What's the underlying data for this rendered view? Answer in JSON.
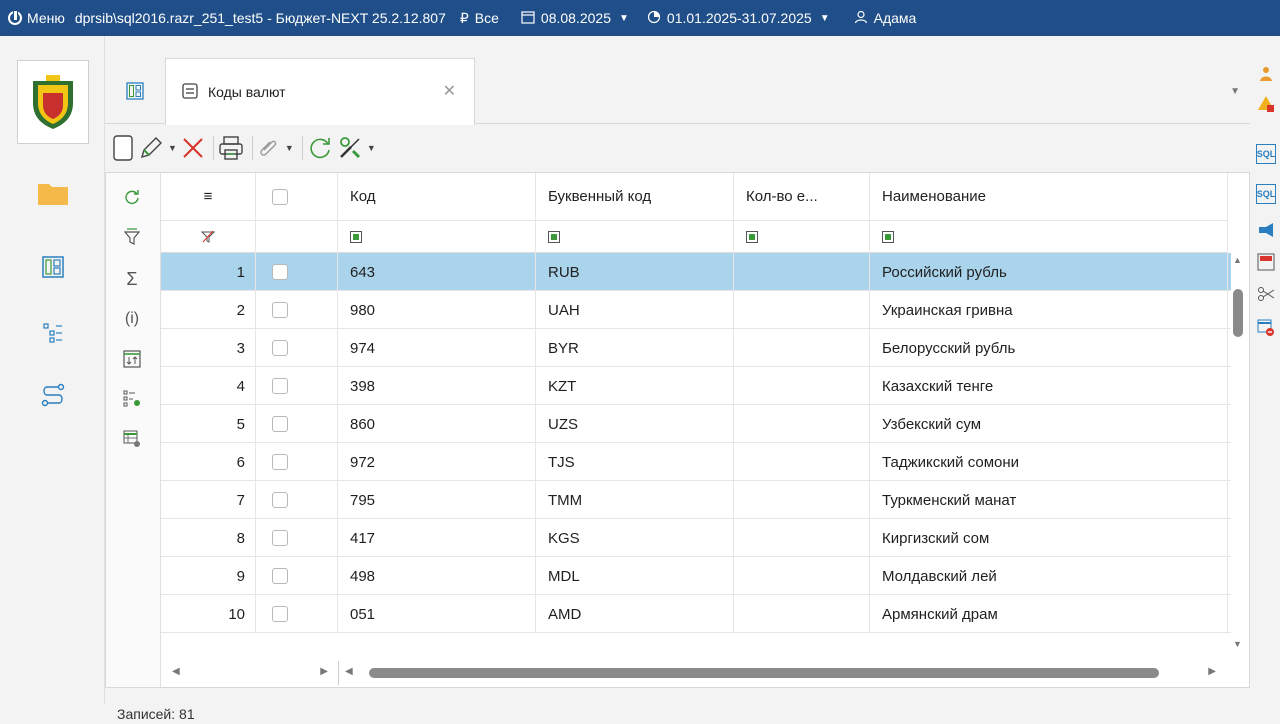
{
  "titlebar": {
    "menu_label": "Меню",
    "connection": "dprsib\\sql2016.razr_251_test5 - Бюджет-NEXT 25.2.12.807",
    "currency_glyph": "₽",
    "currency_filter": "Все",
    "date": "08.08.2025",
    "period": "01.01.2025-31.07.2025",
    "user": "Адама"
  },
  "tabs": [
    {
      "label": "Коды валют"
    }
  ],
  "grid": {
    "columns": [
      "Код",
      "Буквенный код",
      "Кол-во е...",
      "Наименование"
    ],
    "rows": [
      {
        "n": "1",
        "code": "643",
        "alpha": "RUB",
        "qty": "",
        "name": "Российский рубль"
      },
      {
        "n": "2",
        "code": "980",
        "alpha": "UAH",
        "qty": "",
        "name": "Украинская гривна"
      },
      {
        "n": "3",
        "code": "974",
        "alpha": "BYR",
        "qty": "",
        "name": "Белорусский рубль"
      },
      {
        "n": "4",
        "code": "398",
        "alpha": "KZT",
        "qty": "",
        "name": "Казахский тенге"
      },
      {
        "n": "5",
        "code": "860",
        "alpha": "UZS",
        "qty": "",
        "name": "Узбекский сум"
      },
      {
        "n": "6",
        "code": "972",
        "alpha": "TJS",
        "qty": "",
        "name": "Таджикский сомони"
      },
      {
        "n": "7",
        "code": "795",
        "alpha": "TMM",
        "qty": "",
        "name": "Туркменский манат"
      },
      {
        "n": "8",
        "code": "417",
        "alpha": "KGS",
        "qty": "",
        "name": "Киргизский сом"
      },
      {
        "n": "9",
        "code": "498",
        "alpha": "MDL",
        "qty": "",
        "name": "Молдавский лей"
      },
      {
        "n": "10",
        "code": "051",
        "alpha": "AMD",
        "qty": "",
        "name": "Армянский драм"
      }
    ],
    "selected_row": 0
  },
  "status": {
    "records": "Записей: 81"
  },
  "colors": {
    "titlebar": "#1f4e88",
    "selection": "#aad3ec",
    "accent_green": "#3a9a3a",
    "folder": "#f5b94a"
  }
}
